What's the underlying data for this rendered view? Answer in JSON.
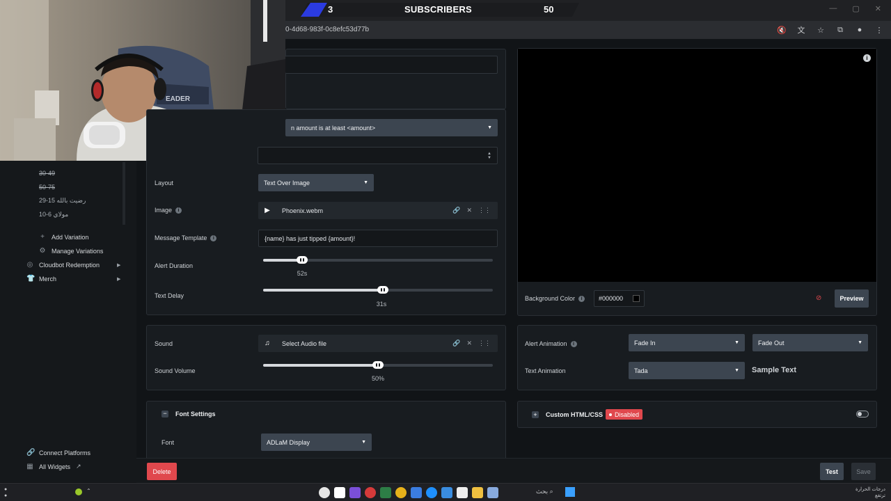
{
  "overlay": {
    "subscribers_current": "3",
    "subscribers_title": "SUBSCRIBERS",
    "subscribers_goal": "50",
    "subscribers_progress": 0.06
  },
  "browser": {
    "url_fragment": "0-4d68-983f-0c8efc53d77b"
  },
  "sidebar": {
    "variations": [
      "30-49",
      "50-75",
      "رضيت بالله 15-29",
      "مولاي 6-10"
    ],
    "add_variation": "Add Variation",
    "manage_variations": "Manage Variations",
    "cloudbot_redemption": "Cloudbot Redemption",
    "merch": "Merch",
    "connect_platforms": "Connect Platforms",
    "all_widgets": "All Widgets"
  },
  "settings": {
    "condition_select": "n amount is at least <amount>",
    "layout_label": "Layout",
    "layout_value": "Text Over Image",
    "image_label": "Image",
    "image_file": "Phoenix.webm",
    "message_template_label": "Message Template",
    "message_template_value": "{name} has just tipped {amount}!",
    "alert_duration_label": "Alert Duration",
    "alert_duration_value": "52s",
    "alert_duration_fraction": 0.17,
    "text_delay_label": "Text Delay",
    "text_delay_value": "31s",
    "text_delay_fraction": 0.52,
    "sound_label": "Sound",
    "sound_file": "Select Audio file",
    "sound_volume_label": "Sound Volume",
    "sound_volume_value": "50%",
    "sound_volume_fraction": 0.5,
    "font_settings_title": "Font Settings",
    "font_label": "Font",
    "font_value": "ADLaM Display"
  },
  "preview": {
    "background_color_label": "Background Color",
    "background_color_value": "#000000",
    "preview_button": "Preview",
    "alert_animation_label": "Alert Animation",
    "fade_in": "Fade In",
    "fade_out": "Fade Out",
    "text_animation_label": "Text Animation",
    "text_animation_value": "Tada",
    "sample_text": "Sample Text",
    "custom_html_label": "Custom HTML/CSS",
    "custom_html_status": "Disabled"
  },
  "actions": {
    "delete": "Delete",
    "test": "Test",
    "save": "Save"
  },
  "taskbar": {
    "search_text": "بحث",
    "weather_line1": "درجات الحرارة",
    "weather_line2": "ترتفع"
  },
  "colors": {
    "accent_blue": "#2b3be0",
    "danger": "#e0484d",
    "select_bg": "#3c4550"
  }
}
